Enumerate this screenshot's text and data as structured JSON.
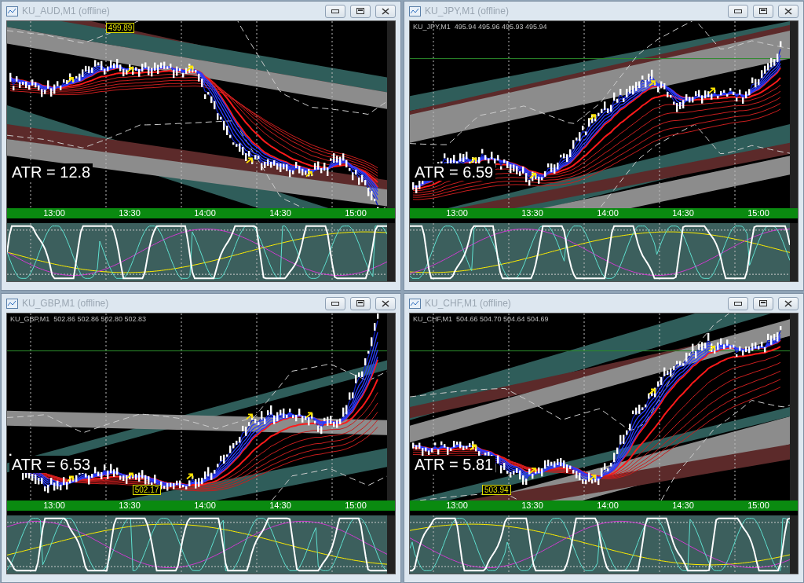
{
  "windows": [
    {
      "title": "KU_AUD,M1 (offline)",
      "atr": "ATR = 12.8",
      "price_tag": "499.89",
      "time_labels": [
        "13:00",
        "13:30",
        "14:00",
        "14:30",
        "15:00"
      ]
    },
    {
      "title": "KU_JPY,M1 (offline)",
      "header": "KU_JPY,M1  495.94 495.96 495.93 495.94",
      "atr": "ATR = 6.59",
      "time_labels": [
        "13:00",
        "13:30",
        "14:00",
        "14:30",
        "15:00"
      ]
    },
    {
      "title": "KU_GBP,M1 (offline)",
      "header": "KU_GBP,M1  502.86 502.86 502.80 502.83",
      "atr": "ATR = 6.53",
      "price_tag": "502.17",
      "time_labels": [
        "13:00",
        "13:30",
        "14:00",
        "14:30",
        "15:00"
      ]
    },
    {
      "title": "KU_CHF,M1 (offline)",
      "header": "KU_CHF,M1  504.66 504.70 504.64 504.69",
      "atr": "ATR = 5.81",
      "price_tag": "503.94",
      "time_labels": [
        "13:00",
        "13:30",
        "14:00",
        "14:30",
        "15:00"
      ]
    }
  ]
}
